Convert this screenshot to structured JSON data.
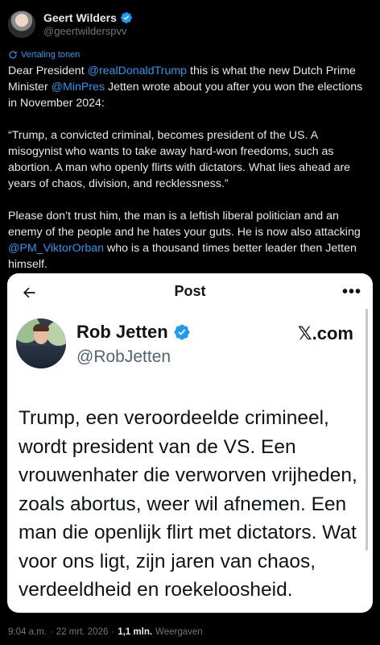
{
  "author": {
    "name": "Geert Wilders",
    "handle": "@geertwilderspvv"
  },
  "translate_label": "Vertaling tonen",
  "tweet": {
    "p1_pre": "Dear President ",
    "p1_mention1": "@realDonaldTrump",
    "p1_mid": " this is what the new Dutch Prime Minister ",
    "p1_mention2": "@MinPres",
    "p1_post": " Jetten wrote about you after you won the elections in November 2024:",
    "p2": "“Trump, a convicted criminal, becomes president of the US. A misogynist who wants to take away hard-won freedoms, such as abortion. A man who openly flirts with dictators. What lies ahead are years of chaos, division, and recklessness.”",
    "p3_pre": "Please don’t trust him, the man is a leftish liberal politician and an enemy of the people and he hates your guts. He is now also attacking ",
    "p3_mention": "@PM_ViktorOrban",
    "p3_post": " who is a thousand times better leader then Jetten himself."
  },
  "embed": {
    "title": "Post",
    "name": "Rob Jetten",
    "handle": "@RobJetten",
    "site": "𝕏.com",
    "text": "Trump, een veroordeelde crimineel, wordt president van de VS. Een vrouwenhater die verworven vrijheden, zoals abortus, weer wil afnemen. Een man die openlijk flirt met dictators. Wat voor ons ligt, zijn jaren van chaos, verdeeldheid en roekeloosheid."
  },
  "footer": {
    "time": "9:04 a.m.",
    "sep1": "·",
    "date": "22 mrt. 2026",
    "sep2": "·",
    "views_count": "1,1 mln.",
    "views_label": "Weergaven"
  },
  "colors": {
    "link": "#1d9bf0",
    "verified": "#1d9bf0",
    "secondary_text": "#71767b"
  }
}
